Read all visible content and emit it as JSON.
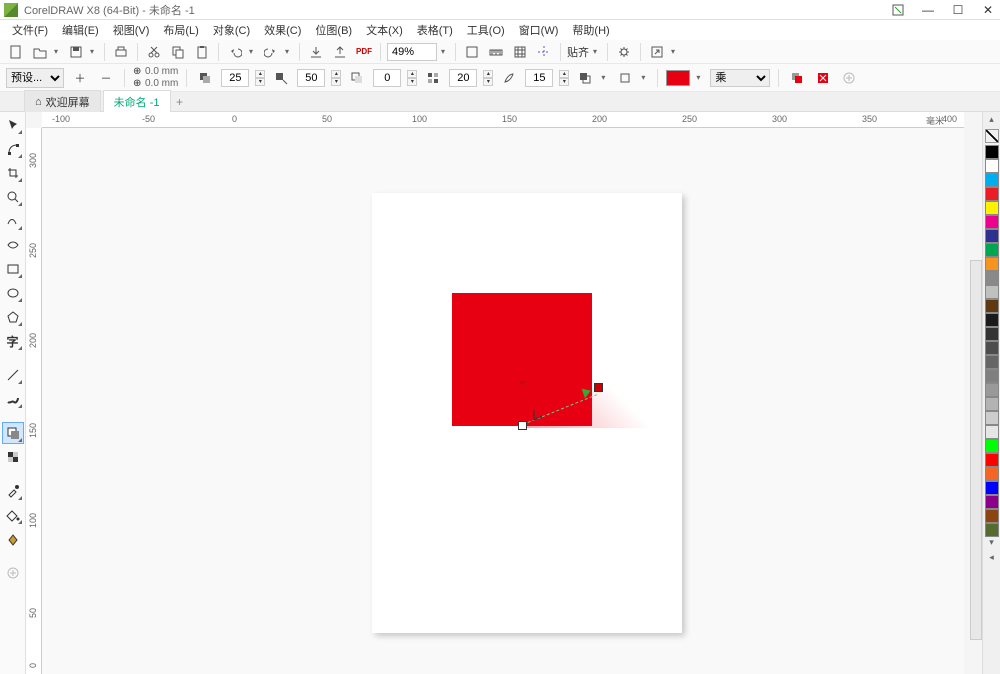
{
  "titlebar": {
    "app": "CorelDRAW X8 (64-Bit)",
    "doc": "未命名 -1"
  },
  "win": {
    "min": "—",
    "max": "☐",
    "close": "✕",
    "aux": "⬚"
  },
  "menu": {
    "file": "文件(F)",
    "edit": "编辑(E)",
    "view": "视图(V)",
    "layout": "布局(L)",
    "object": "对象(C)",
    "effects": "效果(C)",
    "bitmap": "位图(B)",
    "text": "文本(X)",
    "table": "表格(T)",
    "tools": "工具(O)",
    "window": "窗口(W)",
    "help": "帮助(H)"
  },
  "tb1": {
    "zoom": "49%",
    "snap_label": "贴齐"
  },
  "tb2": {
    "preset": "预设...",
    "dim_x": "0.0 mm",
    "dim_y": "0.0 mm",
    "v1": "25",
    "v2": "50",
    "v3": "0",
    "v4": "20",
    "v5": "15",
    "blend": "乘",
    "color": "#e60012"
  },
  "tabs": {
    "welcome": "欢迎屏幕",
    "doc": "未命名 -1",
    "add": "+"
  },
  "ruler": {
    "h": [
      "-100",
      "-50",
      "0",
      "50",
      "100",
      "150",
      "200",
      "250",
      "300",
      "350",
      "400"
    ],
    "v": [
      "300",
      "250",
      "200",
      "150",
      "100",
      "50",
      "0"
    ],
    "unit": "毫米"
  },
  "palette": [
    "#000000",
    "#ffffff",
    "#00aeef",
    "#ed1c24",
    "#fff200",
    "#ec008c",
    "#2e3192",
    "#00a651",
    "#f7941d",
    "#898989",
    "#c0c0c0",
    "#603913",
    "#1a1a1a",
    "#333333",
    "#4d4d4d",
    "#666666",
    "#808080",
    "#999999",
    "#b3b3b3",
    "#cccccc",
    "#e6e6e6",
    "#00ff00",
    "#ff0000",
    "#f26522",
    "#0000ff",
    "#8b008b",
    "#8b4513",
    "#556b2f"
  ],
  "icons": {
    "new": "new",
    "open": "open",
    "save": "save",
    "print": "print",
    "cut": "cut",
    "copy": "copy",
    "paste": "paste",
    "undo": "undo",
    "redo": "redo",
    "import": "import",
    "export": "export",
    "pdf": "pdf",
    "fullscreen": "full",
    "showrulers": "rulers",
    "grid": "grid",
    "guides": "guides",
    "opts": "opts",
    "launch": "launch"
  }
}
